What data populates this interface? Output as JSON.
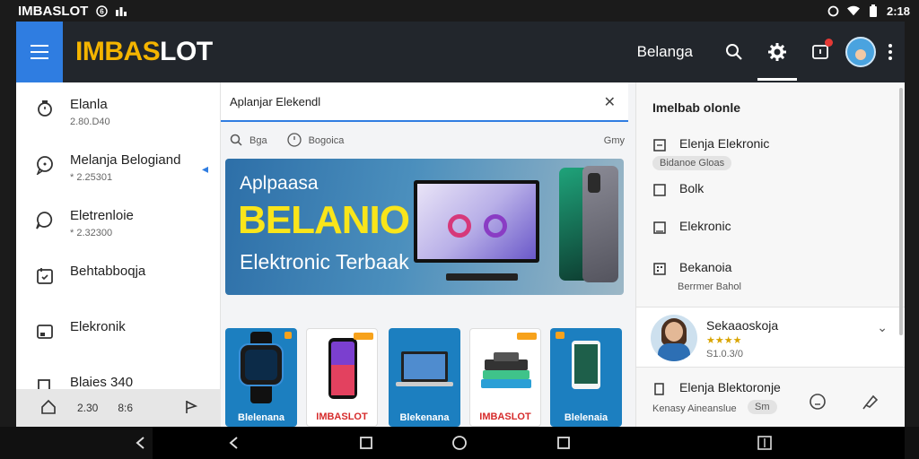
{
  "status_bar": {
    "app_name": "IMBASLOT",
    "time": "2:18"
  },
  "topbar": {
    "logo_part1": "IMBAS",
    "logo_part2": "LOT",
    "belanja_label": "Belanga"
  },
  "sidebar": {
    "items": [
      {
        "label": "Elanla",
        "sub": "2.80.D40"
      },
      {
        "label": "Melanja Belogiand",
        "sub": "* 2.25301"
      },
      {
        "label": "Eletrenloie",
        "sub": "* 2.32300"
      },
      {
        "label": "Behtabboqja",
        "sub": ""
      },
      {
        "label": "Elekronik",
        "sub": ""
      },
      {
        "label": "Blaies 340",
        "sub": ""
      }
    ],
    "bottom_text1": "2.30",
    "bottom_text2": "8:6"
  },
  "search": {
    "value": "Aplanjar Elekendl"
  },
  "filters": {
    "item1": "Bga",
    "item2": "Bogoica",
    "right": "Gmy"
  },
  "banner": {
    "line1": "Aplpaasa",
    "line2": "BELANIO",
    "line3": "Elektronic Terbaak"
  },
  "cards": [
    {
      "label": "Blelenana",
      "bg": "#1c7fc0",
      "label_color": "#ffffff"
    },
    {
      "label": "IMBASLOT",
      "bg": "#ffffff",
      "label_color": "#d62b2b"
    },
    {
      "label": "Blekenana",
      "bg": "#1c7fc0",
      "label_color": "#ffffff"
    },
    {
      "label": "IMBASLOT",
      "bg": "#ffffff",
      "label_color": "#d62b2b"
    },
    {
      "label": "Blelenaia",
      "bg": "#1c7fc0",
      "label_color": "#ffffff"
    }
  ],
  "right_panel": {
    "title": "Imelbab olonle",
    "items": [
      {
        "label": "Elenja Elekronic"
      },
      {
        "label": "Bolk"
      },
      {
        "label": "Elekronic"
      },
      {
        "label": "Bekanoia"
      },
      {
        "label": "Elenja Blektoronje"
      }
    ],
    "item1_pill": "Bidanoe Gloas",
    "item4_sub": "Berrmer Bahol",
    "item5_sub": "Kenasy Aineanslue",
    "item5_pill": "Sm",
    "profile": {
      "name": "Sekaaoskoja",
      "rating": "★★★★",
      "value": "S1.0.3/0"
    }
  },
  "colors": {
    "accent": "#2f7de1",
    "logo_yellow": "#f4b400",
    "topbar_bg": "#22262c",
    "banner_yellow": "#f9e51a"
  }
}
